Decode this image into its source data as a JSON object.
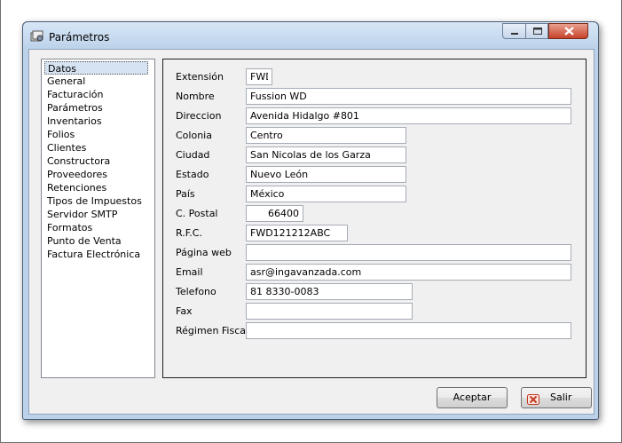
{
  "window": {
    "title": "Parámetros",
    "icon": "app-settings-icon"
  },
  "nav": {
    "items": [
      {
        "label": "Datos",
        "selected": true
      },
      {
        "label": "General"
      },
      {
        "label": "Facturación"
      },
      {
        "label": "Parámetros"
      },
      {
        "label": "Inventarios"
      },
      {
        "label": "Folios"
      },
      {
        "label": "Clientes"
      },
      {
        "label": "Constructora"
      },
      {
        "label": "Proveedores"
      },
      {
        "label": "Retenciones"
      },
      {
        "label": "Tipos de Impuestos"
      },
      {
        "label": "Servidor SMTP"
      },
      {
        "label": "Formatos"
      },
      {
        "label": "Punto de Venta"
      },
      {
        "label": "Factura Electrónica"
      }
    ]
  },
  "form": {
    "extension": {
      "label": "Extensión",
      "value": "FWD"
    },
    "nombre": {
      "label": "Nombre",
      "value": "Fussion WD"
    },
    "direccion": {
      "label": "Direccion",
      "value": "Avenida Hidalgo #801"
    },
    "colonia": {
      "label": "Colonia",
      "value": "Centro"
    },
    "ciudad": {
      "label": "Ciudad",
      "value": "San Nicolas de los Garza"
    },
    "estado": {
      "label": "Estado",
      "value": "Nuevo León"
    },
    "pais": {
      "label": "País",
      "value": "México"
    },
    "cpostal": {
      "label": "C. Postal",
      "value": "66400"
    },
    "rfc": {
      "label": "R.F.C.",
      "value": "FWD121212ABC"
    },
    "paginaweb": {
      "label": "Página web",
      "value": ""
    },
    "email": {
      "label": "Email",
      "value": "asr@ingavanzada.com"
    },
    "telefono": {
      "label": "Telefono",
      "value": "81 8330-0083"
    },
    "fax": {
      "label": "Fax",
      "value": ""
    },
    "regimen": {
      "label": "Régimen Fiscal",
      "value": ""
    }
  },
  "buttons": {
    "accept": "Aceptar",
    "exit": "Salir"
  },
  "colors": {
    "window_frame": "#bcd2ea",
    "close_button": "#c7412a",
    "selection": "#d5e3f3"
  }
}
